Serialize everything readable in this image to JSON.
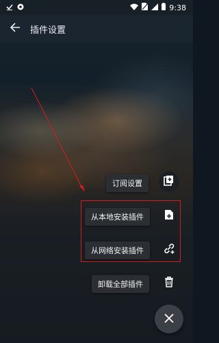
{
  "status_bar": {
    "time": "9:38",
    "left_icons": [
      "check-icon",
      "circle-dot-icon"
    ],
    "right_icons": [
      "wifi-icon",
      "sim-blocked-icon",
      "signal-icon",
      "battery-icon"
    ]
  },
  "toolbar": {
    "back_icon": "arrow-left-icon",
    "title": "插件设置"
  },
  "fab_menu": {
    "items": [
      {
        "label": "订阅设置",
        "icon": "subscription-add-icon"
      },
      {
        "label": "从本地安装插件",
        "icon": "file-add-icon"
      },
      {
        "label": "从网络安装插件",
        "icon": "link-add-icon"
      },
      {
        "label": "卸载全部插件",
        "icon": "trash-icon"
      }
    ],
    "close_icon": "close-icon"
  },
  "annotation": {
    "color": "#d21d1d"
  }
}
